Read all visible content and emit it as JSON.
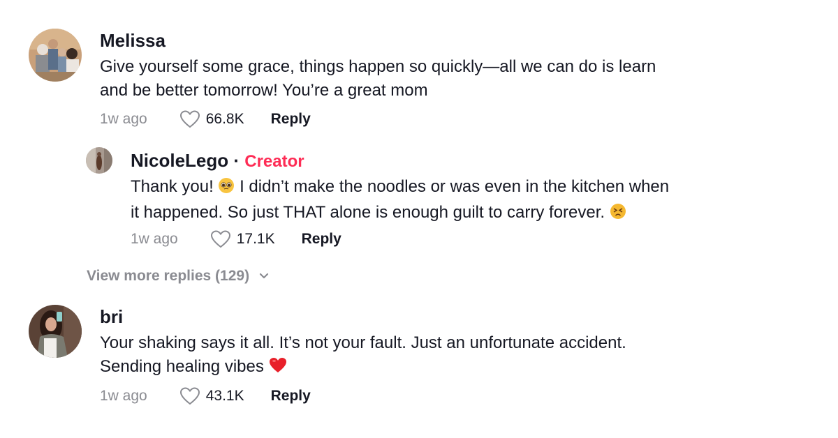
{
  "comments": [
    {
      "username": "Melissa",
      "text_line1": "Give yourself some grace, things happen so quickly—all we can do is learn",
      "text_line2": "and be better tomorrow! You’re a great mom",
      "time": "1w ago",
      "likes": "66.8K",
      "reply_label": "Reply",
      "reply": {
        "username": "NicoleLego",
        "separator": " · ",
        "badge": "Creator",
        "text_line1_a": "Thank you! ",
        "text_line1_emoji": "pleading-face-emoji",
        "text_line1_b": " I didn’t make the noodles or was even in the kitchen when",
        "text_line2": "it happened. So just THAT alone is enough guilt to carry forever. ",
        "text_line2_emoji": "tired-face-emoji",
        "time": "1w ago",
        "likes": "17.1K",
        "reply_label": "Reply"
      },
      "view_more": "View more replies (129)"
    },
    {
      "username": "bri",
      "text_line1": "Your shaking says it all. It’s not your fault. Just an unfortunate accident.",
      "text_line2": "Sending healing vibes ",
      "text_line2_emoji": "red-heart-emoji",
      "time": "1w ago",
      "likes": "43.1K",
      "reply_label": "Reply"
    }
  ],
  "colors": {
    "creator_badge": "#fe2c55",
    "text": "#161823",
    "muted": "#8a8b91"
  }
}
